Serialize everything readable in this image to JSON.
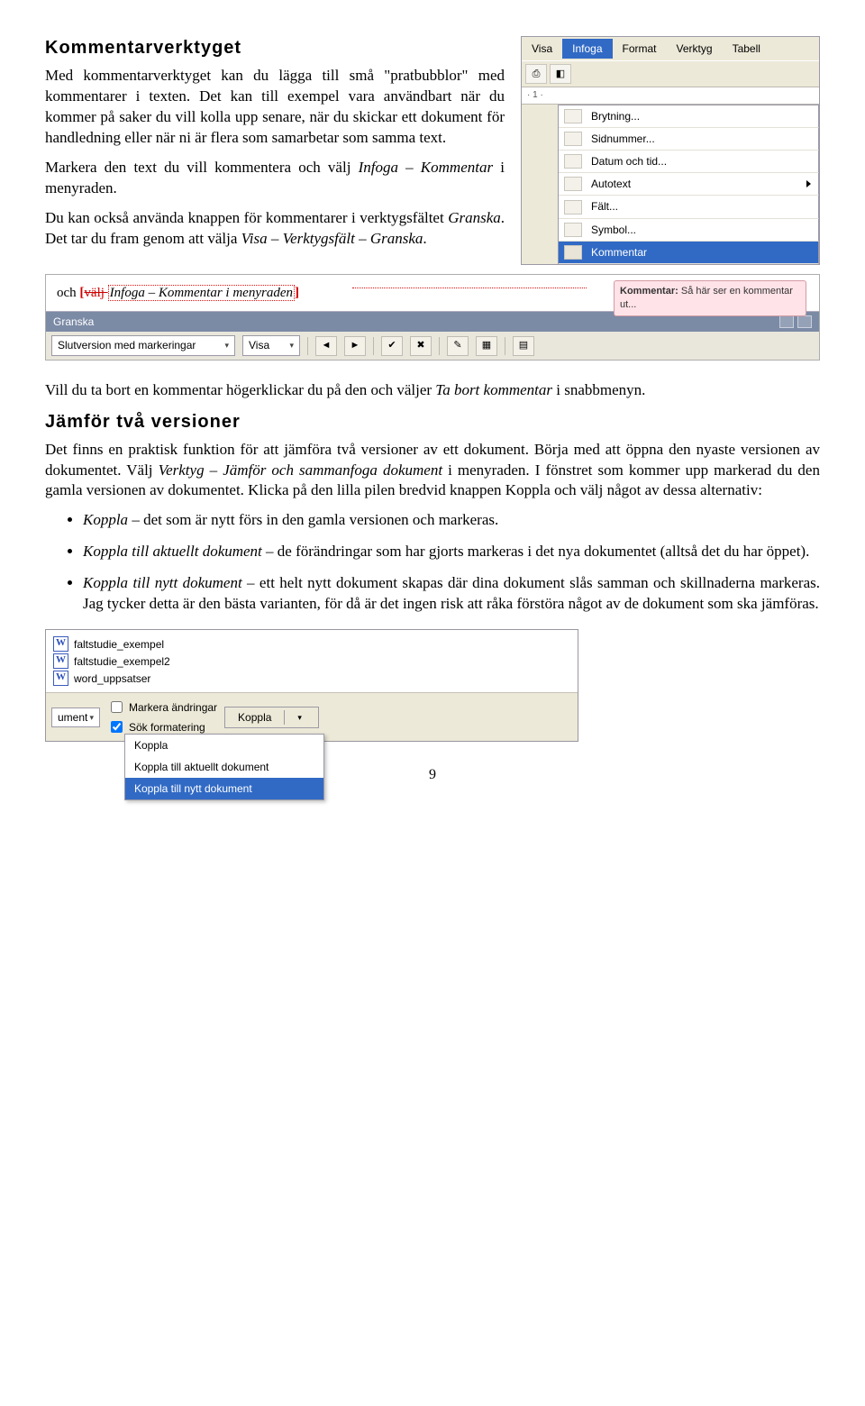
{
  "section1": {
    "title": "Kommentarverktyget",
    "p1a": "Med kommentarverktyget kan du lägga till små \"pratbubblor\" med kommentarer i texten. Det kan till exempel vara användbart när du kommer på saker du vill kolla upp senare, när du skickar ett dokument för handledning eller när ni är flera som samarbetar som samma text.",
    "p2a": "Markera den text du vill kommentera och välj ",
    "p2b": "Infoga – Kommentar",
    "p2c": " i menyraden.",
    "p3a": "Du kan också använda knappen för kommentarer i verktygsfältet ",
    "p3b": "Granska",
    "p3c": ". Det tar du fram genom att välja ",
    "p3d": "Visa – Verktygsfält – Granska",
    "p3e": "."
  },
  "menu": {
    "items": [
      "Visa",
      "Infoga",
      "Format",
      "Verktyg",
      "Tabell"
    ],
    "active_index": 1,
    "dropdown": [
      {
        "label": "Brytning..."
      },
      {
        "label": "Sidnummer..."
      },
      {
        "label": "Datum och tid..."
      },
      {
        "label": "Autotext",
        "arrow": true
      },
      {
        "label": "Fält..."
      },
      {
        "label": "Symbol..."
      },
      {
        "label": "Kommentar",
        "highlight": true
      }
    ],
    "ruler": "· 1 ·"
  },
  "comment_ui": {
    "doc_prefix": "och ",
    "doc_bracket_open": "[",
    "doc_struck": "välj ",
    "doc_highlighted": "Infoga – Kommentar i menyraden",
    "doc_bracket_close": "]",
    "callout_title": "Kommentar:",
    "callout_text": " Så här ser en kommentar ut...",
    "panel_title": "Granska",
    "combo1": "Slutversion med markeringar",
    "combo2": "Visa"
  },
  "p_remove": {
    "a": "Vill du ta bort en kommentar högerklickar du på den och väljer ",
    "b": "Ta bort kommentar",
    "c": " i snabbmenyn."
  },
  "section2": {
    "title": "Jämför två versioner",
    "p1a": "Det finns en praktisk funktion för att jämföra två versioner av ett dokument. Börja med att öppna den nyaste versionen av dokumentet. Välj ",
    "p1b": "Verktyg – Jämför och sammanfoga dokument",
    "p1c": " i menyraden. I fönstret som kommer upp markerad du den gamla versionen av dokumentet. Klicka på den lilla pilen bredvid knappen Koppla och välj något av dessa alternativ:"
  },
  "bullets": [
    {
      "i": "Koppla",
      "t": " – det som är nytt förs in den gamla versionen och markeras."
    },
    {
      "i": "Koppla till aktuellt dokument",
      "t": " – de förändringar som har gjorts markeras i det nya dokumentet (alltså det du har öppet)."
    },
    {
      "i": "Koppla till nytt dokument",
      "t": " – ett helt nytt dokument skapas där dina dokument slås samman och skillnaderna markeras. Jag tycker detta är den bästa varianten, för då är det ingen risk att råka förstöra något av de dokument som ska jämföras."
    }
  ],
  "file_pane": {
    "files": [
      "faltstudie_exempel",
      "faltstudie_exempel2",
      "word_uppsatser"
    ],
    "left_label": "ument",
    "chk1": "Markera ändringar",
    "chk2": "Sök formatering",
    "main_btn": "Koppla",
    "menu": [
      "Koppla",
      "Koppla till aktuellt dokument",
      "Koppla till nytt dokument"
    ],
    "menu_hl": 2
  },
  "page_number": "9"
}
